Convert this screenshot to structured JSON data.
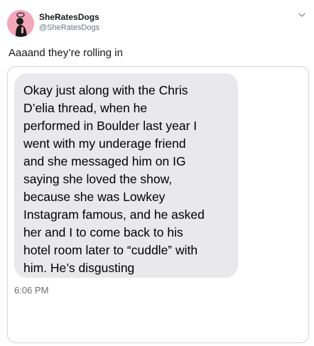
{
  "account": {
    "name": "SheRatesDogs",
    "handle": "@SheRatesDogs",
    "avatar_icon": "profile-avatar-icon",
    "avatar_color": "#f4a7b9"
  },
  "tweet": {
    "text": "Aaaand they’re rolling in"
  },
  "message": {
    "lines": [
      "Okay just along with the Chris",
      "D’elia thread, when he",
      "performed in Boulder last year I",
      "went with my underage friend",
      "and she messaged him on IG",
      "saying she loved the show,",
      "because she was Lowkey",
      "Instagram famous, and he asked",
      "her and I to come back to his",
      "hotel room later to “cuddle” with",
      "him. He’s disgusting"
    ],
    "time": "6:06 PM",
    "bubble_color": "#e9e9eb"
  },
  "menu_icon": "chevron-down-icon"
}
